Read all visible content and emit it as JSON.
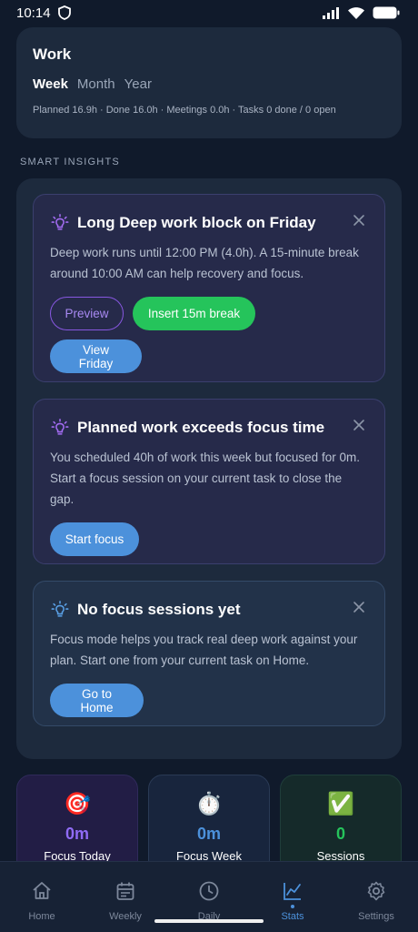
{
  "status_bar": {
    "time": "10:14"
  },
  "summary": {
    "title": "Work",
    "tabs": [
      "Week",
      "Month",
      "Year"
    ],
    "active_tab": "Week",
    "stats": "Planned 16.9h · Done 16.0h · Meetings 0.0h · Tasks 0 done / 0 open"
  },
  "insights": {
    "section_label": "SMART INSIGHTS",
    "cards": [
      {
        "title": "Long Deep work block on Friday",
        "body": "Deep work runs until 12:00 PM (4.0h). A 15-minute break around 10:00 AM can help recovery and focus.",
        "buttons": [
          "Preview",
          "Insert 15m break",
          "View Friday"
        ],
        "accent": "#a36cf2"
      },
      {
        "title": "Planned work exceeds focus time",
        "body": "You scheduled 40h of work this week but focused for 0m. Start a focus session on your current task to close the gap.",
        "buttons": [
          "Start focus"
        ],
        "accent": "#a36cf2"
      },
      {
        "title": "No focus sessions yet",
        "body": "Focus mode helps you track real deep work against your plan. Start one from your current task on Home.",
        "buttons": [
          "Go to Home"
        ],
        "accent": "#5aa0e6"
      }
    ]
  },
  "tiles": [
    {
      "icon": "🎯",
      "icon_name": "target-icon",
      "value": "0m",
      "label": "Focus Today",
      "color": "#8f6bf5"
    },
    {
      "icon": "⏱️",
      "icon_name": "stopwatch-icon",
      "value": "0m",
      "label": "Focus Week",
      "color": "#4c91db"
    },
    {
      "icon": "✅",
      "icon_name": "check-icon",
      "value": "0",
      "label": "Sessions",
      "color": "#25c45b"
    }
  ],
  "nav": {
    "items": [
      {
        "label": "Home",
        "icon": "home-icon"
      },
      {
        "label": "Weekly",
        "icon": "calendar-icon"
      },
      {
        "label": "Daily",
        "icon": "clock-icon"
      },
      {
        "label": "Stats",
        "icon": "chart-icon"
      },
      {
        "label": "Settings",
        "icon": "gear-icon"
      }
    ],
    "active": "Stats"
  },
  "colors": {
    "background": "#101a2b",
    "card": "#1d2a3d",
    "accent_blue": "#4c91db",
    "accent_green": "#25c45b",
    "accent_purple": "#8757e0"
  }
}
